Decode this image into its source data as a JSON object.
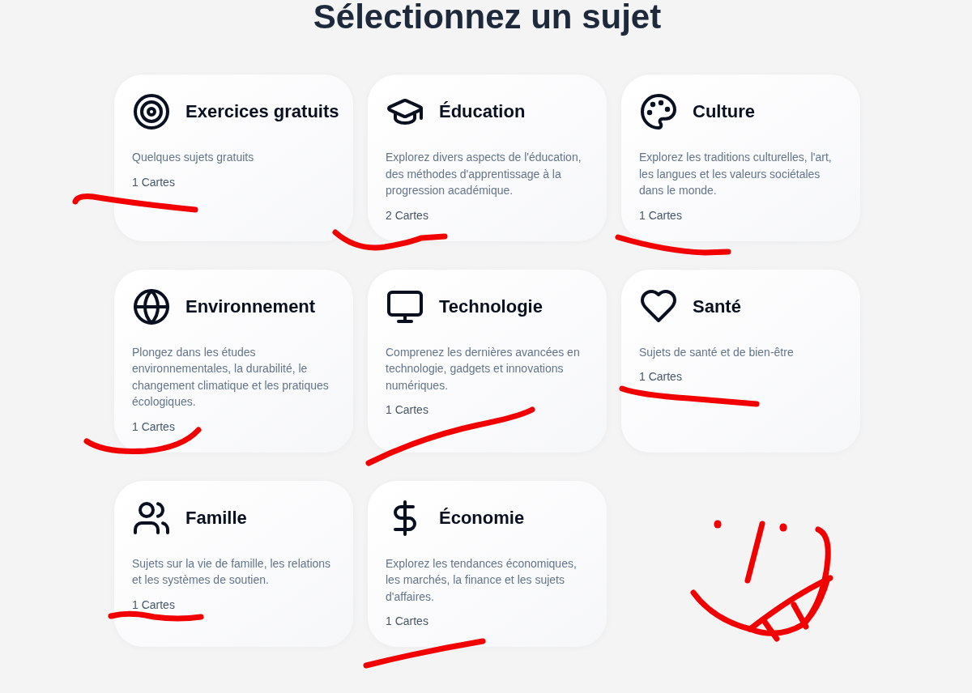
{
  "heading": "Sélectionnez un sujet",
  "subjects": [
    {
      "kind": "target",
      "title": "Exercices gratuits",
      "description": "Quelques sujets gratuits",
      "count": "1 Cartes"
    },
    {
      "kind": "graduation",
      "title": "Éducation",
      "description": "Explorez divers aspects de l'éducation, des méthodes d'apprentissage à la progression académique.",
      "count": "2 Cartes"
    },
    {
      "kind": "palette",
      "title": "Culture",
      "description": "Explorez les traditions culturelles, l'art, les langues et les valeurs sociétales dans le monde.",
      "count": "1 Cartes"
    },
    {
      "kind": "globe",
      "title": "Environnement",
      "description": "Plongez dans les études environnementales, la durabilité, le changement climatique et les pratiques écologiques.",
      "count": "1 Cartes"
    },
    {
      "kind": "monitor",
      "title": "Technologie",
      "description": "Comprenez les dernières avancées en technologie, gadgets et innovations numériques.",
      "count": "1 Cartes"
    },
    {
      "kind": "heart",
      "title": "Santé",
      "description": "Sujets de santé et de bien-être",
      "count": "1 Cartes"
    },
    {
      "kind": "people",
      "title": "Famille",
      "description": "Sujets sur la vie de famille, les relations et les systèmes de soutien.",
      "count": "1 Cartes"
    },
    {
      "kind": "dollar",
      "title": "Économie",
      "description": "Explorez les tendances économiques, les marchés, la finance et les sujets d'affaires.",
      "count": "1 Cartes"
    }
  ]
}
